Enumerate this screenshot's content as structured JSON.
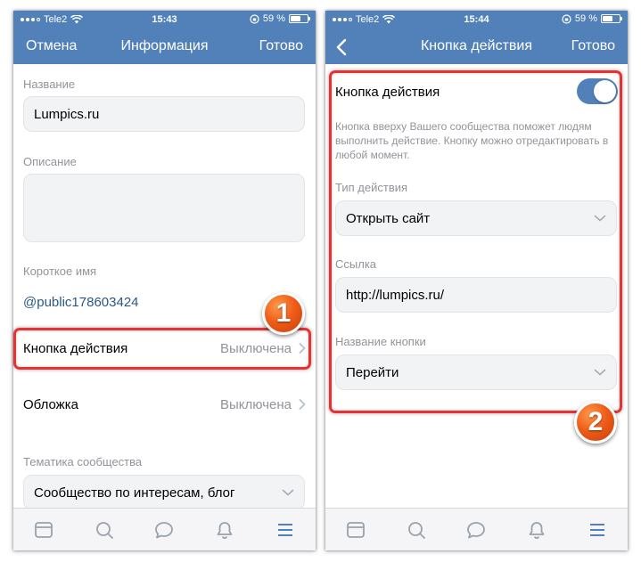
{
  "left": {
    "status": {
      "carrier": "Tele2",
      "time": "15:43",
      "battery": "59 %",
      "battery_level": 0.59
    },
    "nav": {
      "cancel": "Отмена",
      "title": "Информация",
      "done": "Готово"
    },
    "name": {
      "label": "Название",
      "value": "Lumpics.ru"
    },
    "description": {
      "label": "Описание",
      "value": ""
    },
    "short_name": {
      "label": "Короткое имя",
      "value": "@public178603424"
    },
    "action_button": {
      "label": "Кнопка действия",
      "value": "Выключена"
    },
    "cover": {
      "label": "Обложка",
      "value": "Выключена"
    },
    "topic": {
      "label": "Тематика сообщества",
      "value": "Сообщество по интересам, блог"
    },
    "badge": "1"
  },
  "right": {
    "status": {
      "carrier": "Tele2",
      "time": "15:44",
      "battery": "59 %",
      "battery_level": 0.59
    },
    "nav": {
      "title": "Кнопка действия",
      "done": "Готово"
    },
    "toggle": {
      "label": "Кнопка действия",
      "on": true
    },
    "description": "Кнопка вверху Вашего сообщества поможет людям выполнить действие. Кнопку можно отредактировать в любой момент.",
    "action_type": {
      "label": "Тип действия",
      "value": "Открыть сайт"
    },
    "link": {
      "label": "Ссылка",
      "value": "http://lumpics.ru/"
    },
    "button_name": {
      "label": "Название кнопки",
      "value": "Перейти"
    },
    "badge": "2"
  },
  "tabs": [
    "news-icon",
    "search-icon",
    "messages-icon",
    "notifications-icon",
    "menu-icon"
  ],
  "colors": {
    "header": "#5181b8",
    "link": "#2a5885",
    "highlight": "#e53333",
    "badge": "#f05d1a"
  }
}
